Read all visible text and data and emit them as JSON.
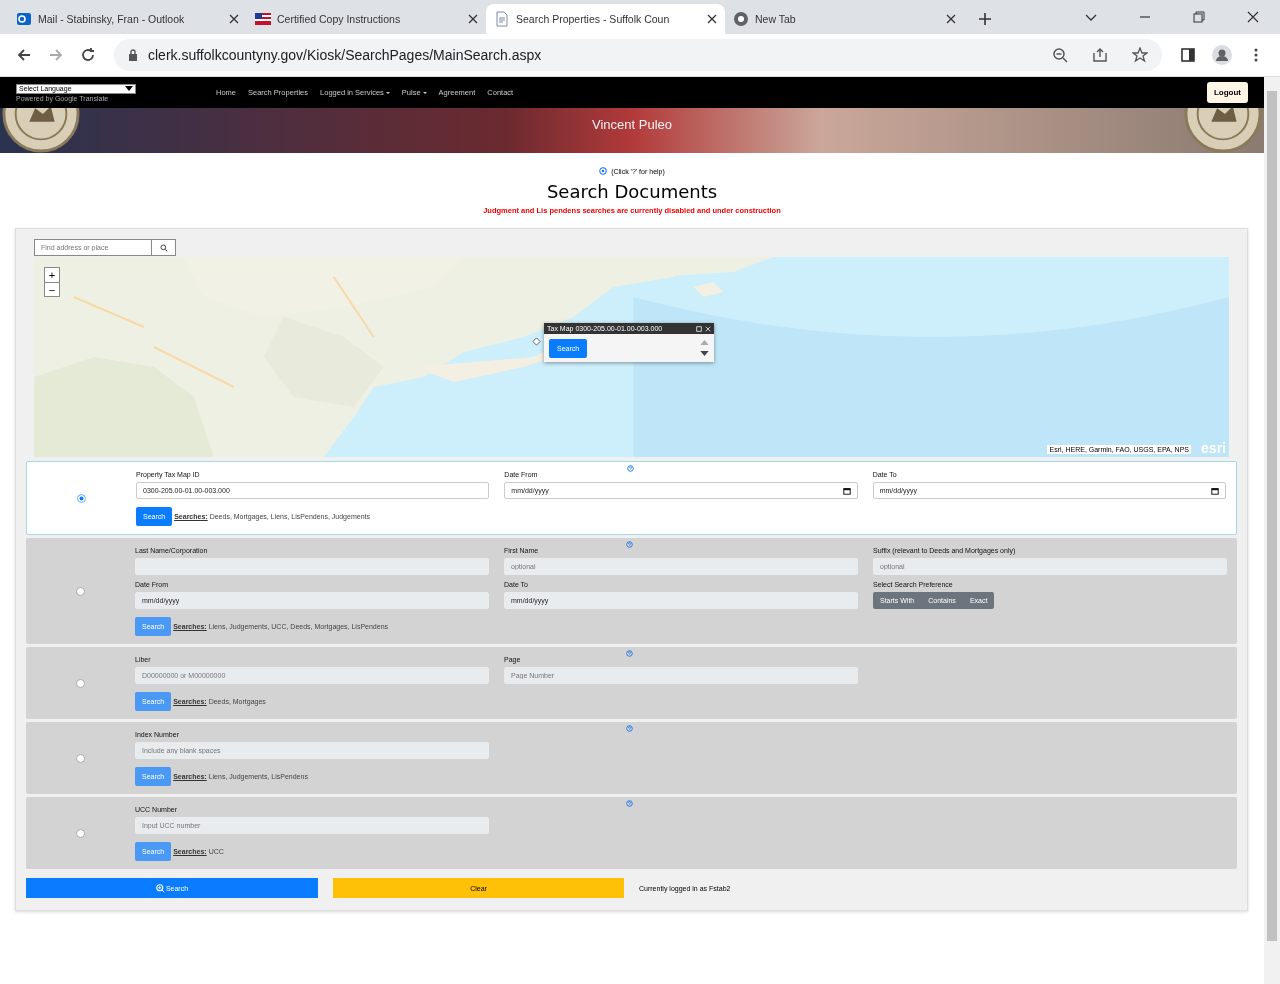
{
  "browser": {
    "tabs": [
      {
        "title": "Mail - Stabinsky, Fran - Outlook",
        "kind": "mail",
        "selected": false
      },
      {
        "title": "Certified Copy Instructions",
        "kind": "flag",
        "selected": false
      },
      {
        "title": "Search Properties - Suffolk Coun",
        "kind": "doc",
        "selected": true
      },
      {
        "title": "New Tab",
        "kind": "globe",
        "selected": false
      }
    ],
    "address": "clerk.suffolkcountyny.gov/Kiosk/SearchPages/MainSearch.aspx"
  },
  "navbar": {
    "language_select": "Select Language",
    "translate_note": "Powered by Google Translate",
    "links": [
      {
        "label": "Home",
        "dropdown": false
      },
      {
        "label": "Search Properties",
        "dropdown": false
      },
      {
        "label": "Logged in Services",
        "dropdown": true
      },
      {
        "label": "Pulse",
        "dropdown": true
      },
      {
        "label": "Agreement",
        "dropdown": false
      },
      {
        "label": "Contact",
        "dropdown": false
      }
    ],
    "logout": "Logout"
  },
  "banner": {
    "subtitle": "Vincent Puleo"
  },
  "help_note": "(Click '?' for help)",
  "title": "Search Documents",
  "warning": "Judgment and Lis pendens searches are currently disabled and under construction",
  "map": {
    "search_placeholder": "Find address or place",
    "zoom_in": "+",
    "zoom_out": "−",
    "popup": {
      "title": "Tax Map 0300-205.00-01.00-003.000",
      "button": "Search"
    },
    "attribution": "Esri, HERE, Garmin, FAO, USGS, EPA, NPS",
    "logo": "esri"
  },
  "sections": [
    {
      "selected": true,
      "rows": [
        [
          {
            "kind": "text",
            "label": "Property Tax Map ID",
            "value": "0300-205.00-01.00-003.000"
          },
          {
            "kind": "date",
            "label": "Date From",
            "placeholder": "mm/dd/yyyy"
          },
          {
            "kind": "date",
            "label": "Date To",
            "placeholder": "mm/dd/yyyy"
          }
        ]
      ],
      "button": "Search",
      "searches_label": "Searches:",
      "searches": "Deeds, Mortgages, Liens, LisPendens, Judgements"
    },
    {
      "selected": false,
      "rows": [
        [
          {
            "kind": "text",
            "label": "Last Name/Corporation"
          },
          {
            "kind": "text",
            "label": "First Name",
            "placeholder": "optional"
          },
          {
            "kind": "text",
            "label": "Suffix (relevant to Deeds and Mortgages only)",
            "placeholder": "optional"
          }
        ],
        [
          {
            "kind": "date",
            "label": "Date From",
            "placeholder": "mm/dd/yyyy"
          },
          {
            "kind": "date",
            "label": "Date To",
            "placeholder": "mm/dd/yyyy"
          },
          {
            "kind": "choice",
            "label": "Select Search Preference",
            "options": [
              {
                "label": "Starts With",
                "selected": false
              },
              {
                "label": "Contains",
                "selected": false
              },
              {
                "label": "Exact",
                "selected": false
              }
            ]
          }
        ]
      ],
      "button": "Search",
      "searches_label": "Searches:",
      "searches": "Liens, Judgements, UCC, Deeds, Mortgages, LisPendens"
    },
    {
      "selected": false,
      "rows": [
        [
          {
            "kind": "text",
            "label": "Liber",
            "placeholder": "D00000000 or M00000000"
          },
          {
            "kind": "text",
            "label": "Page",
            "placeholder": "Page Number"
          }
        ]
      ],
      "button": "Search",
      "searches_label": "Searches:",
      "searches": "Deeds, Mortgages"
    },
    {
      "selected": false,
      "rows": [
        [
          {
            "kind": "text",
            "label": "Index Number",
            "placeholder": "Include any blank spaces"
          }
        ]
      ],
      "button": "Search",
      "searches_label": "Searches:",
      "searches": "Liens, Judgements, LisPendens"
    },
    {
      "selected": false,
      "rows": [
        [
          {
            "kind": "text",
            "label": "UCC Number",
            "placeholder": "Input UCC number"
          }
        ]
      ],
      "button": "Search",
      "searches_label": "Searches:",
      "searches": "UCC"
    }
  ],
  "footer": {
    "search": "Search",
    "clear": "Clear",
    "status": "Currently logged in as Fstab2"
  }
}
